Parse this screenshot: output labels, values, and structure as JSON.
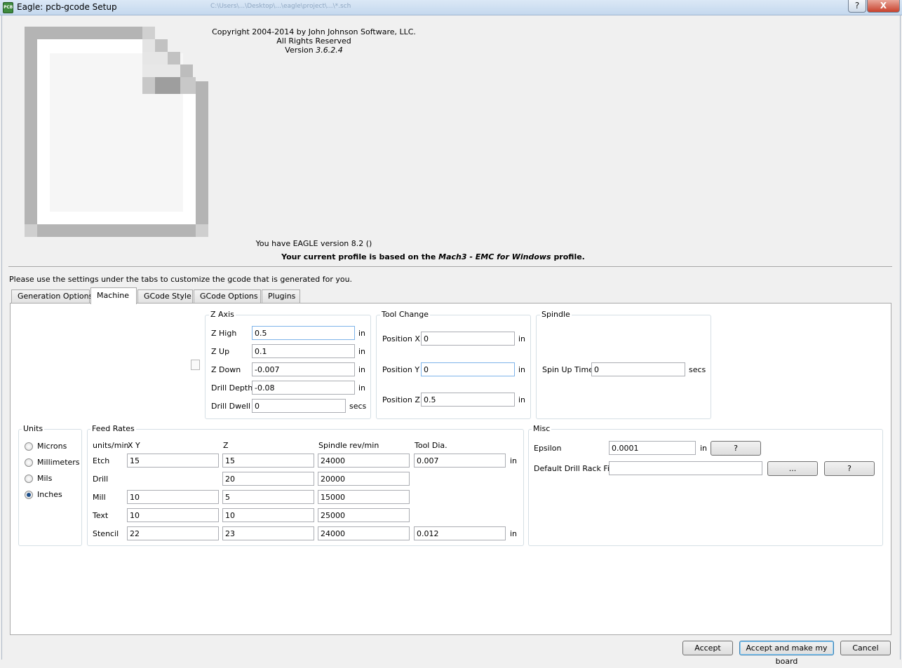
{
  "window": {
    "title": "Eagle: pcb-gcode Setup",
    "help_label": "?",
    "close_label": "X",
    "background_title": "C:\\Users\\...\\Desktop\\...\\eagle\\project\\...\\*.sch"
  },
  "about": {
    "copyright": "Copyright 2004-2014 by John Johnson Software, LLC.",
    "rights": "All Rights Reserved",
    "version_label": "Version",
    "version": "3.6.2.4",
    "eagle_version": "You have EAGLE version 8.2 ()",
    "profile_prefix": "Your current profile is based on the",
    "profile_name": "Mach3 - EMC for Windows",
    "profile_suffix": "profile."
  },
  "instructions": "Please use the settings under the tabs to customize the gcode that is generated for you.",
  "tabs": [
    {
      "label": "Generation Options",
      "active": false
    },
    {
      "label": "Machine",
      "active": true
    },
    {
      "label": "GCode Style",
      "active": false
    },
    {
      "label": "GCode Options",
      "active": false
    },
    {
      "label": "Plugins",
      "active": false
    }
  ],
  "z_axis": {
    "title": "Z Axis",
    "rows": [
      {
        "label": "Z High",
        "value": "0.5",
        "unit": "in"
      },
      {
        "label": "Z Up",
        "value": "0.1",
        "unit": "in"
      },
      {
        "label": "Z Down",
        "value": "-0.007",
        "unit": "in"
      },
      {
        "label": "Drill Depth",
        "value": "-0.08",
        "unit": "in"
      },
      {
        "label": "Drill Dwell",
        "value": "0",
        "unit": "secs"
      }
    ]
  },
  "tool_change": {
    "title": "Tool Change",
    "rows": [
      {
        "label": "Position X",
        "value": "0",
        "unit": "in"
      },
      {
        "label": "Position Y",
        "value": "0",
        "unit": "in"
      },
      {
        "label": "Position Z",
        "value": "0.5",
        "unit": "in"
      }
    ]
  },
  "spindle": {
    "title": "Spindle",
    "label": "Spin Up Time",
    "value": "0",
    "unit": "secs"
  },
  "units": {
    "title": "Units",
    "options": [
      "Microns",
      "Millimeters",
      "Mils",
      "Inches"
    ],
    "selected": "Inches"
  },
  "feed_rates": {
    "title": "Feed Rates",
    "headers": {
      "units": "units/min",
      "xy": "X Y",
      "z": "Z",
      "spindle": "Spindle rev/min",
      "tool": "Tool Dia."
    },
    "rows": [
      {
        "label": "Etch",
        "xy": "15",
        "z": "15",
        "spindle": "24000",
        "tool": "0.007",
        "unit": "in"
      },
      {
        "label": "Drill",
        "xy": null,
        "z": "20",
        "spindle": "20000",
        "tool": null,
        "unit": null
      },
      {
        "label": "Mill",
        "xy": "10",
        "z": "5",
        "spindle": "15000",
        "tool": null,
        "unit": null
      },
      {
        "label": "Text",
        "xy": "10",
        "z": "10",
        "spindle": "25000",
        "tool": null,
        "unit": null
      },
      {
        "label": "Stencil",
        "xy": "22",
        "z": "23",
        "spindle": "24000",
        "tool": "0.012",
        "unit": "in"
      }
    ]
  },
  "misc": {
    "title": "Misc",
    "epsilon_label": "Epsilon",
    "epsilon_value": "0.0001",
    "epsilon_unit": "in",
    "epsilon_help": "?",
    "drill_rack_label": "Default Drill Rack File",
    "drill_rack_value": "",
    "browse_label": "...",
    "drill_rack_help": "?"
  },
  "buttons": {
    "accept": "Accept",
    "accept_make": "Accept and make my board",
    "cancel": "Cancel"
  }
}
